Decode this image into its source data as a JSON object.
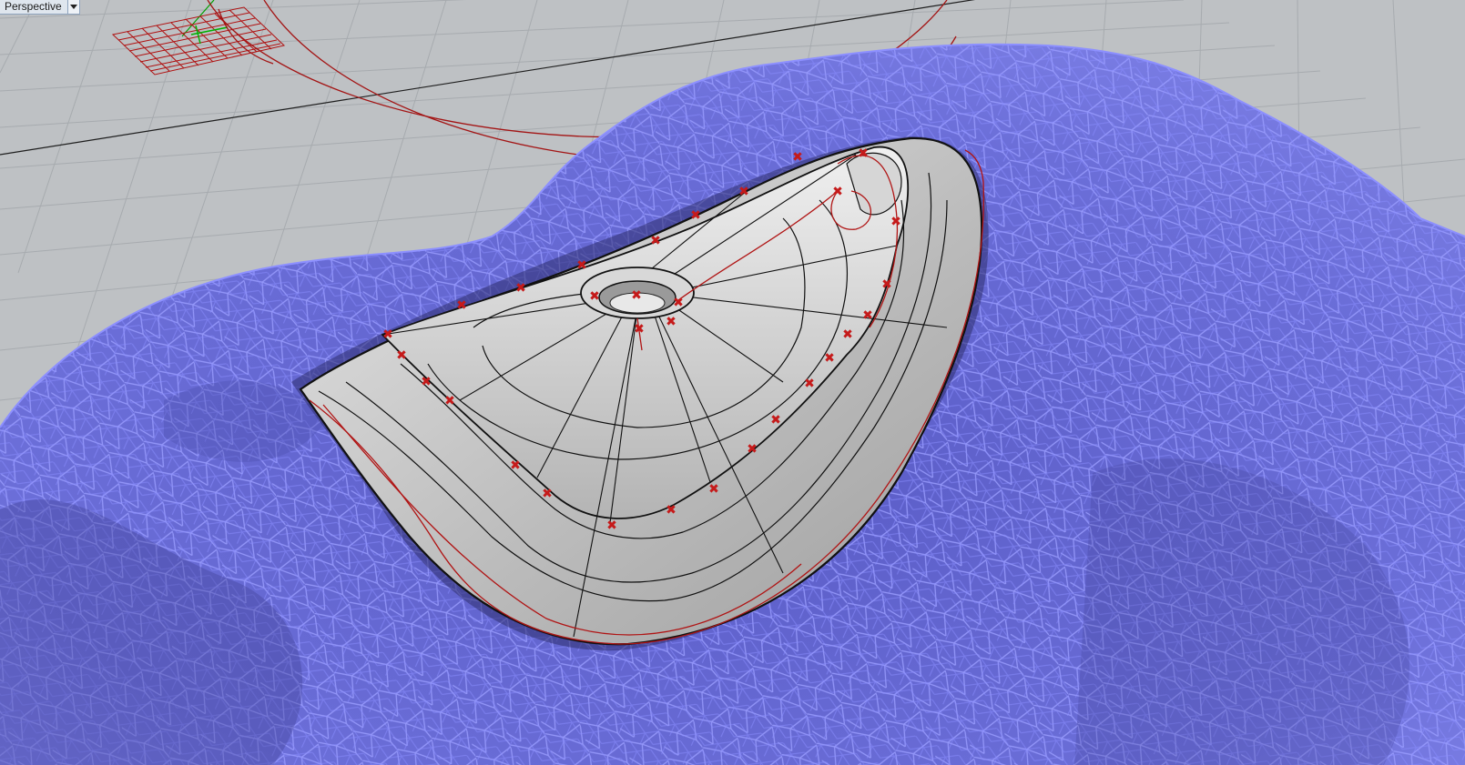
{
  "viewport": {
    "title": "Perspective",
    "menu_icon": "chevron-down-icon"
  },
  "colors": {
    "background": "#bec1c4",
    "grid_line": "#a9adb1",
    "grid_axis": "#222222",
    "mesh_fill": "#6f72d8",
    "mesh_wire": "#8f92ff",
    "surface_fill": "#c8c8c8",
    "surface_edge": "#111111",
    "curve_red": "#b01818",
    "control_point": "#c81818",
    "axis_x": "#c00000",
    "axis_y": "#00b000"
  }
}
